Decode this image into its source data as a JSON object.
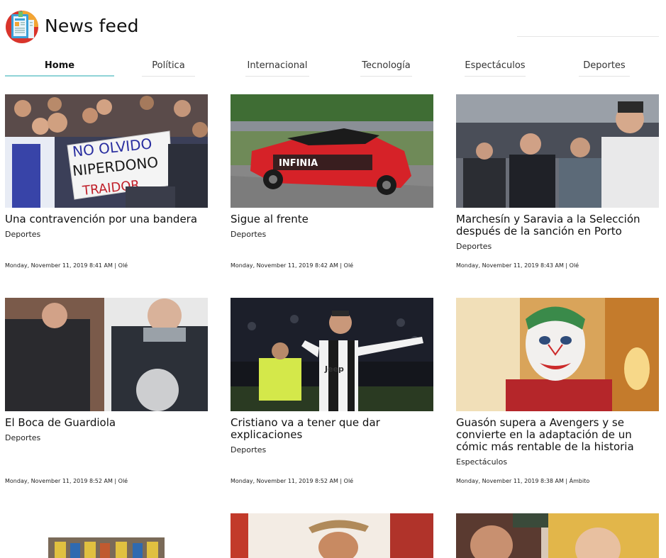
{
  "app": {
    "title": "News feed",
    "logo_icon": "newspaper-icon"
  },
  "nav": {
    "tabs": [
      {
        "label": "Home",
        "active": true
      },
      {
        "label": "Política",
        "active": false
      },
      {
        "label": "Internacional",
        "active": false
      },
      {
        "label": "Tecnología",
        "active": false
      },
      {
        "label": "Espectáculos",
        "active": false
      },
      {
        "label": "Deportes",
        "active": false
      }
    ]
  },
  "articles": [
    {
      "headline": "Una contravención por una bandera",
      "category": "Deportes",
      "meta": "Monday, November 11, 2019 8:41 AM | Olé",
      "banner_text_1": "NO OLVIDO",
      "banner_text_2": "NIPERDONO",
      "banner_text_3": "TRAIDOR"
    },
    {
      "headline": "Sigue al frente",
      "category": "Deportes",
      "meta": "Monday, November 11, 2019 8:42 AM | Olé",
      "car_text": "INFINIA"
    },
    {
      "headline": "Marchesín y Saravia a la Selección después de la sanción en Porto",
      "category": "Deportes",
      "meta": "Monday, November 11, 2019 8:43 AM | Olé"
    },
    {
      "headline": "El Boca de Guardiola",
      "category": "Deportes",
      "meta": "Monday, November 11, 2019 8:52 AM | Olé"
    },
    {
      "headline": "Cristiano va a tener que dar explicaciones",
      "category": "Deportes",
      "meta": "Monday, November 11, 2019 8:52 AM | Olé",
      "shirt_text": "Jeep"
    },
    {
      "headline": "Guasón supera a Avengers y se convierte en la adaptación de un cómic más rentable de la historia",
      "category": "Espectáculos",
      "meta": "Monday, November 11, 2019 8:38 AM | Ámbito"
    }
  ],
  "colors": {
    "active_tab_underline": "#8fd3d7",
    "tab_underline": "#e3e3e3"
  }
}
